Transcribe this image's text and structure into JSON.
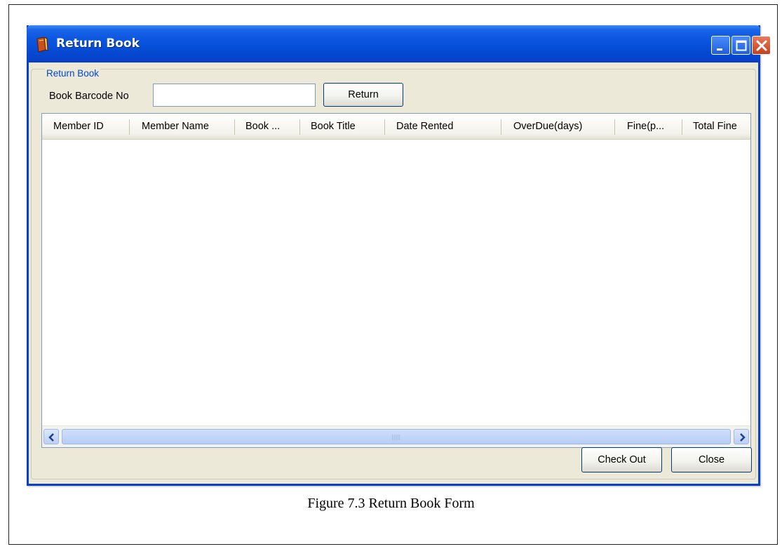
{
  "window": {
    "title": "Return Book",
    "title_bar_color": "#0a55e0",
    "buttons": [
      "minimize-icon",
      "maximize-icon",
      "close-icon"
    ]
  },
  "group": {
    "legend": "Return Book"
  },
  "barcode": {
    "label": "Book Barcode No",
    "value": "",
    "button_label": "Return"
  },
  "table": {
    "columns": [
      "Member ID",
      "Member Name",
      "Book ...",
      "Book Title",
      "Date Rented",
      "OverDue(days)",
      "Fine(p...",
      "Total Fine"
    ],
    "rows": []
  },
  "footer": {
    "checkout_label": "Check Out",
    "close_label": "Close"
  },
  "caption": "Figure 7.3 Return Book Form"
}
